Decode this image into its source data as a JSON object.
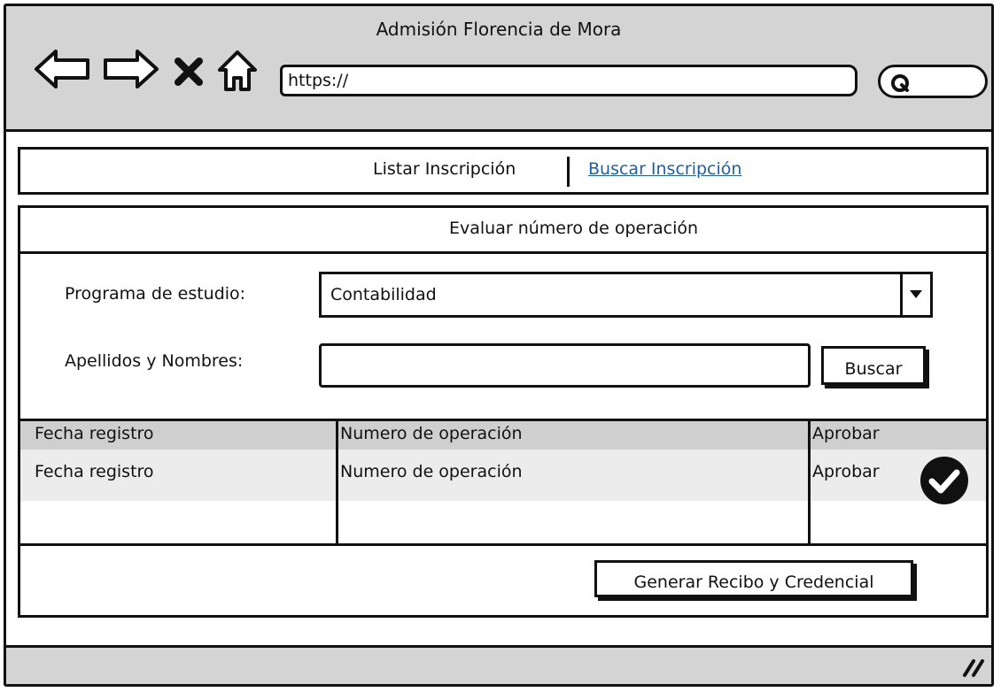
{
  "window": {
    "title": "Admisión Florencia de Mora"
  },
  "browser": {
    "url": "https://",
    "icons": [
      "back-arrow-icon",
      "forward-arrow-icon",
      "close-x-icon",
      "home-icon",
      "search-icon"
    ]
  },
  "tabs": [
    {
      "label": "Listar Inscripción",
      "active": true
    },
    {
      "label": "Buscar Inscripción",
      "active": false,
      "link": true
    }
  ],
  "section": {
    "title": "Evaluar número de operación"
  },
  "form": {
    "program_label": "Programa de estudio:",
    "program_value": "Contabilidad",
    "name_label": "Apellidos y Nombres:",
    "name_value": "",
    "search_button": "Buscar"
  },
  "table": {
    "headers": [
      "Fecha registro",
      "Numero de operación",
      "Aprobar"
    ],
    "rows": [
      [
        "Fecha registro",
        "Numero de operación",
        "Aprobar"
      ]
    ]
  },
  "actions": {
    "generate_button": "Generar Recibo y Credencial"
  },
  "colors": {
    "chrome": "#d4d4d4",
    "header_row": "#cfcfcf",
    "data_row": "#ececec",
    "link": "#1f5fa8"
  }
}
